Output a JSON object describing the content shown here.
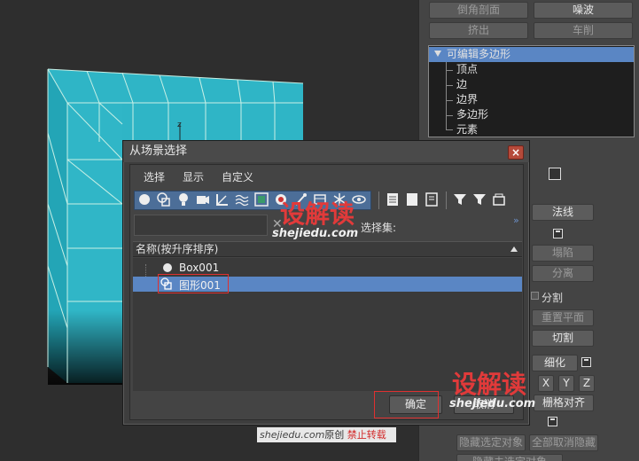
{
  "command_panel": {
    "top_buttons": [
      "倒角剖面",
      "噪波",
      "挤出",
      "车削"
    ],
    "modifier_stack": {
      "root": "可编辑多边形",
      "subobjects": [
        "顶点",
        "边",
        "边界",
        "多边形",
        "元素"
      ]
    },
    "labels": {
      "normals": "法线",
      "collapse": "塌陷",
      "detach": "分离",
      "split": "分割",
      "reset_plane": "重置平面",
      "slice": "切割",
      "refine": "细化",
      "x": "X",
      "y": "Y",
      "z": "Z",
      "grid_align": "栅格对齐",
      "hide_selected": "隐藏选定对象",
      "unhide_all": "全部取消隐藏",
      "hide_unselected": "隐藏未选定对象"
    }
  },
  "dialog": {
    "title": "从场景选择",
    "close_label": "×",
    "menu": [
      "选择",
      "显示",
      "自定义"
    ],
    "filter_placeholder": "",
    "selection_set_label": "选择集:",
    "list_header": "名称(按升序排序)",
    "items": [
      {
        "name": "Box001",
        "icon": "sphere-icon"
      },
      {
        "name": "图形001",
        "icon": "shape-icon",
        "selected": true
      }
    ],
    "ok_label": "确定",
    "cancel_label": "取消"
  },
  "watermarks": {
    "logo_text": "设解读",
    "url": "shejiedu.com",
    "footer_prefix": "shejiedu.com",
    "footer_original": "原创",
    "footer_forbid": "禁止转载"
  },
  "colors": {
    "selection_blue": "#5a86c4",
    "object_cyan": "#2fb5c6",
    "watermark_red": "#e13a3a"
  }
}
